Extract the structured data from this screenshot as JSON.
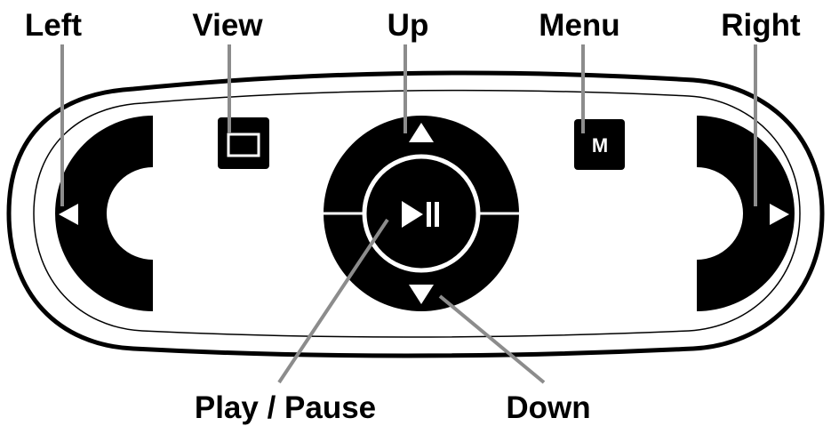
{
  "labels": {
    "left": "Left",
    "view": "View",
    "up": "Up",
    "menu": "Menu",
    "right": "Right",
    "play_pause": "Play / Pause",
    "down": "Down"
  },
  "menu_key_letter": "M",
  "icons": {
    "left": "triangle-left-icon",
    "view": "rectangle-icon",
    "up": "triangle-up-icon",
    "menu": "m-letter-icon",
    "right": "triangle-right-icon",
    "play_pause": "play-pause-icon",
    "down": "triangle-down-icon"
  },
  "colors": {
    "buttons": "#000000",
    "body_outline": "#000000",
    "leader_lines": "#8c8c8c",
    "arrows": "#ffffff"
  }
}
